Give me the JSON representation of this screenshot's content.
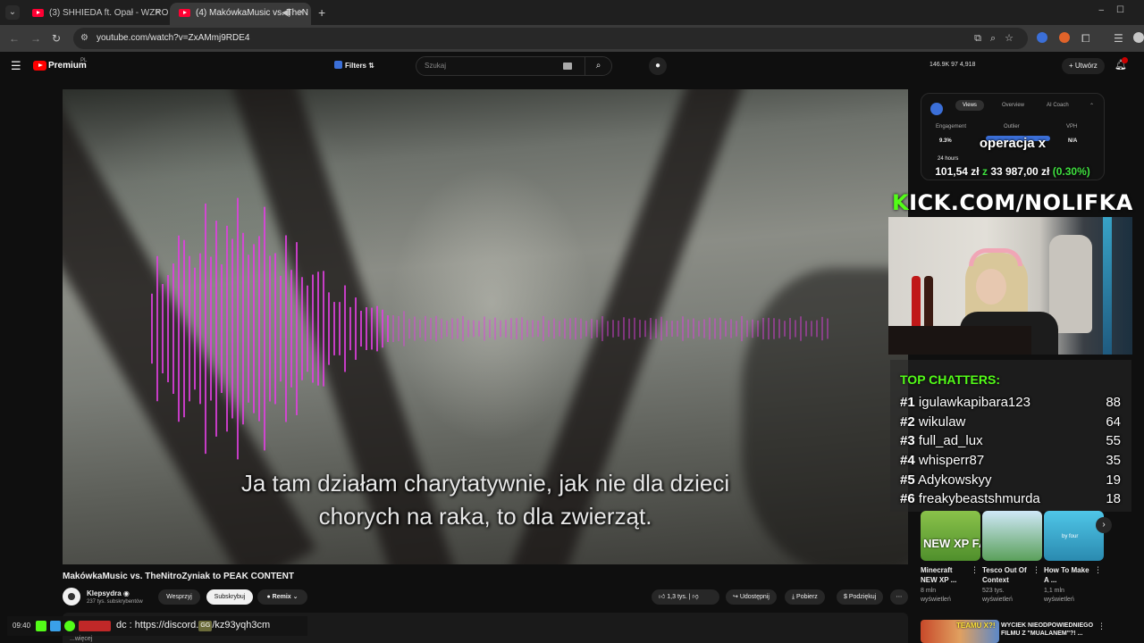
{
  "browser": {
    "tabs": [
      {
        "label": "(3) SHHIEDA ft. Opał - WZROK",
        "active": false
      },
      {
        "label": "(4) MakówkaMusic vs. TheN",
        "active": true
      }
    ],
    "close_glyph": "×",
    "new_tab_glyph": "+",
    "url": "youtube.com/watch?v=ZxAMmj9RDE4"
  },
  "youtube": {
    "brand": "Premium",
    "country": "PL",
    "filters_label": "Filters",
    "search_placeholder": "Szukaj",
    "stats_text": "146.9K  97  4,918",
    "create_label": "Utwórz"
  },
  "video": {
    "subtitle_line1": "Ja tam działam charytatywnie, jak nie dla dzieci",
    "subtitle_line2": "chorych na raka, to dla zwierząt.",
    "title": "MakówkaMusic vs. TheNitroZyniak to PEAK CONTENT",
    "channel": "Klepsydra",
    "subscribers": "237 tys. subskrybentów",
    "support_label": "Wesprzyj",
    "subscribe_label": "Subskrybuj",
    "remix_label": "Remix",
    "likes": "1,3 tys.",
    "share_label": "Udostępnij",
    "download_label": "Pobierz",
    "thanks_label": "Podziękuj",
    "description_more": "...więcej"
  },
  "stream_overlay": {
    "time": "09:40",
    "discord_text": "dc : https://discord.",
    "discord_suffix": "/kz93yqh3cm",
    "gg_badge": "GG",
    "operation_title": "operacja x",
    "price_text": "101,54 zł",
    "price_sep": "z",
    "price_goal": "33 987,00 zł",
    "price_percent": "(0.30%)",
    "kick_k": "K",
    "kick_rest": "ICK.COM/NOLIFKA",
    "top_chatters_title": "TOP CHATTERS:",
    "chatters": [
      {
        "rank": "#1",
        "name": "igulawkapibara123",
        "count": "88"
      },
      {
        "rank": "#2",
        "name": "wikulaw",
        "count": "64"
      },
      {
        "rank": "#3",
        "name": "full_ad_lux",
        "count": "55"
      },
      {
        "rank": "#4",
        "name": "whisperr87",
        "count": "35"
      },
      {
        "rank": "#5",
        "name": "Adykowskyy",
        "count": "19"
      },
      {
        "rank": "#6",
        "name": "freakybeastshmurda",
        "count": "18"
      }
    ]
  },
  "analytics_panel": {
    "tabs": [
      "Views",
      "Overview",
      "AI Coach"
    ],
    "engagement_label": "Engagement",
    "engagement_value": "9.3%",
    "outlier_label": "Outlier",
    "vph_label": "VPH",
    "vph_value": "N/A",
    "hours_label": "24 hours"
  },
  "recommendations": [
    {
      "title": "Minecraft NEW XP ...",
      "views": "8 mln",
      "views_suffix": "wyświetleń",
      "thumb_text": "NEW XP FARM!"
    },
    {
      "title": "Tesco Out Of Context",
      "views": "523 tys.",
      "views_suffix": "wyświetleń",
      "thumb_text": ""
    },
    {
      "title": "How To Make A ...",
      "views": "1,1 mln",
      "views_suffix": "wyświetleń",
      "thumb_text": "by four"
    }
  ],
  "bottom_rec": {
    "title": "WYCIEK NIEODPOWIEDNIEGO FILMU Z \"MUALANEM\"?! ...",
    "thumb_text": "TEAMU X?!"
  },
  "colors": {
    "kick_green": "#53fc18",
    "yt_red": "#ff0000",
    "wave_pink": "#e040e0"
  }
}
